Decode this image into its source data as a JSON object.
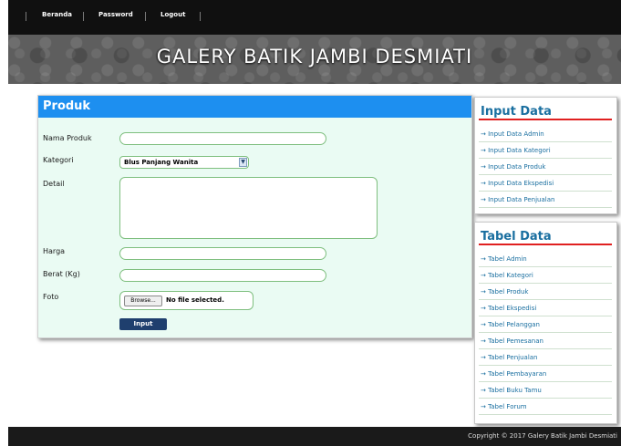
{
  "nav": {
    "items": [
      "Beranda",
      "Password",
      "Logout"
    ]
  },
  "site_title": "GALERY BATIK JAMBI DESMIATI",
  "form": {
    "title": "Produk",
    "fields": {
      "nama_label": "Nama Produk",
      "kategori_label": "Kategori",
      "kategori_value": "Blus Panjang Wanita",
      "detail_label": "Detail",
      "harga_label": "Harga",
      "berat_label": "Berat (Kg)",
      "foto_label": "Foto",
      "browse_label": "Browse...",
      "file_status": "No file selected."
    },
    "submit_label": "Input"
  },
  "sidebar": {
    "input_title": "Input Data",
    "input_links": [
      "Input Data Admin",
      "Input Data Kategori",
      "Input Data Produk",
      "Input Data Ekspedisi",
      "Input Data Penjualan"
    ],
    "tabel_title": "Tabel Data",
    "tabel_links": [
      "Tabel Admin",
      "Tabel Kategori",
      "Tabel Produk",
      "Tabel Ekspedisi",
      "Tabel Pelanggan",
      "Tabel Pemesanan",
      "Tabel Penjualan",
      "Tabel Pembayaran",
      "Tabel Buku Tamu",
      "Tabel Forum"
    ],
    "link_arrow": "→"
  },
  "footer": {
    "text": "Copyright © 2017 Galery Batik Jambi Desmiati"
  }
}
